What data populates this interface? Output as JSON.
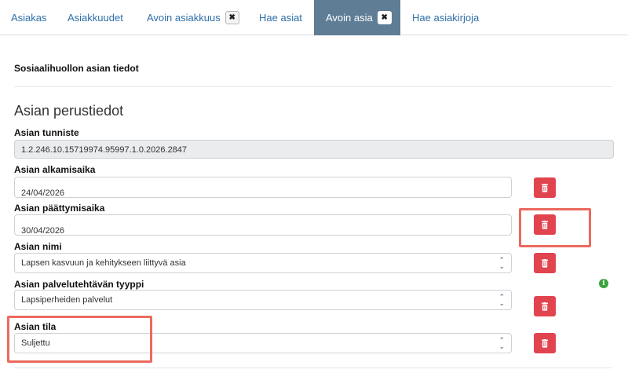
{
  "tabs": [
    {
      "label": "Asiakas"
    },
    {
      "label": "Asiakkuudet"
    },
    {
      "label": "Avoin asiakkuus",
      "close": "✖"
    },
    {
      "label": "Hae asiat"
    },
    {
      "label": "Avoin asia",
      "close": "✖",
      "active": true
    },
    {
      "label": "Hae asiakirjoja"
    }
  ],
  "section_title": "Sosiaalihuollon asian tiedot",
  "heading": "Asian perustiedot",
  "fields": {
    "tunniste": {
      "label": "Asian tunniste",
      "value": "1.2.246.10.15719974.95997.1.0.2026.2847"
    },
    "alkamisaika": {
      "label": "Asian alkamisaika",
      "value": "24/04/2026"
    },
    "paattymisaika": {
      "label": "Asian päättymisaika",
      "value": "30/04/2026"
    },
    "nimi": {
      "label": "Asian nimi",
      "value": "Lapsen kasvuun ja kehitykseen liittyvä asia"
    },
    "tyyppi": {
      "label": "Asian palvelutehtävän tyyppi",
      "value": "Lapsiperheiden palvelut"
    },
    "tila": {
      "label": "Asian tila",
      "value": "Suljettu"
    }
  },
  "icons": {
    "delete": "trash-icon",
    "info": "info-icon",
    "select": "chevron-updown-icon"
  },
  "info_glyph": "i",
  "colors": {
    "tab_active_bg": "#5f7d95",
    "tab_link": "#2f6fa8",
    "delete_button": "#e2444f",
    "highlight": "#ec6a5e",
    "info": "#39a33c"
  }
}
